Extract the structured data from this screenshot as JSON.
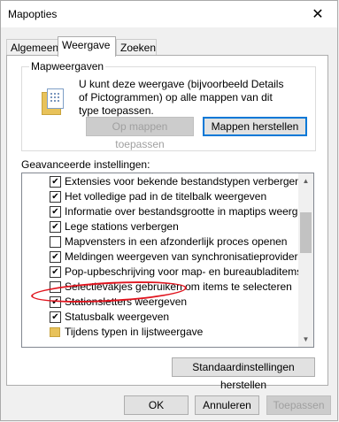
{
  "window": {
    "title": "Mapopties"
  },
  "tabs": [
    {
      "label": "Algemeen"
    },
    {
      "label": "Weergave"
    },
    {
      "label": "Zoeken"
    }
  ],
  "folder_views": {
    "label": "Mapweergaven",
    "description": "U kunt deze weergave (bijvoorbeeld Details of Pictogrammen) op alle mappen van dit type toepassen.",
    "apply_button": "Op mappen toepassen",
    "reset_button": "Mappen herstellen"
  },
  "advanced": {
    "label": "Geavanceerde instellingen:",
    "items": [
      {
        "label": "Extensies voor bekende bestandstypen verbergen",
        "checked": true
      },
      {
        "label": "Het volledige pad in de titelbalk weergeven",
        "checked": true
      },
      {
        "label": "Informatie over bestandsgrootte in maptips weergeven",
        "checked": true
      },
      {
        "label": "Lege stations verbergen",
        "checked": true
      },
      {
        "label": "Mapvensters in een afzonderlijk proces openen",
        "checked": false
      },
      {
        "label": "Meldingen weergeven van synchronisatieprovider",
        "checked": true
      },
      {
        "label": "Pop-upbeschrijving voor map- en bureaubladitems weergeven",
        "checked": true
      },
      {
        "label": "Selectievakjes gebruiken om items te selecteren",
        "checked": false
      },
      {
        "label": "Stationsletters weergeven",
        "checked": true
      },
      {
        "label": "Statusbalk weergeven",
        "checked": true
      },
      {
        "label": "Tijdens typen in lijstweergave",
        "folder": true
      }
    ]
  },
  "restore_defaults_button": "Standaardinstellingen herstellen",
  "footer": {
    "ok": "OK",
    "cancel": "Annuleren",
    "apply": "Toepassen"
  },
  "icons": {
    "close": "close-icon",
    "folder": "folder-icon",
    "scroll_up": "scroll-up-icon",
    "scroll_down": "scroll-down-icon"
  },
  "colors": {
    "highlight_oval": "#e0141e",
    "default_button_border": "#0078d7"
  }
}
